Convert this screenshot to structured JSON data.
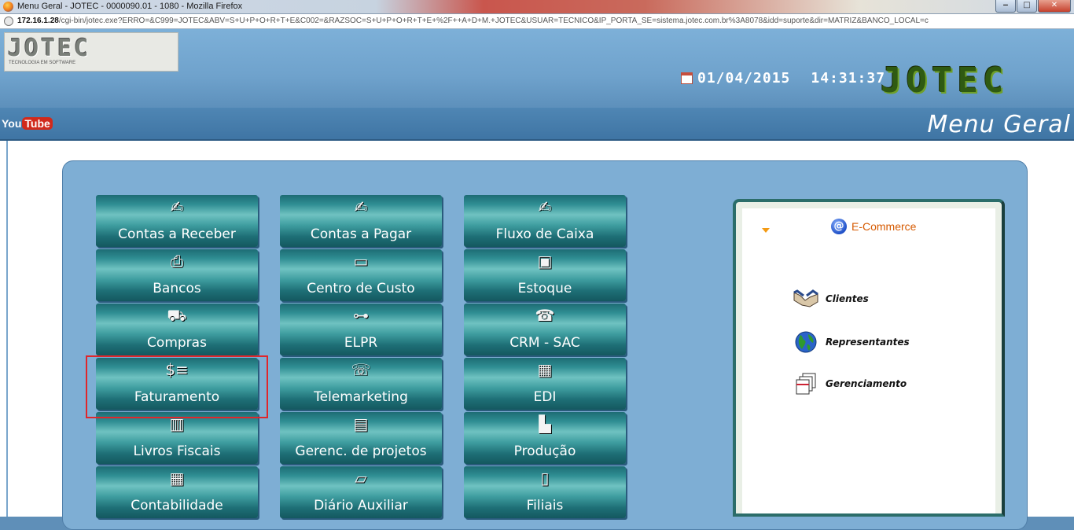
{
  "window": {
    "title": "Menu Geral - JOTEC - 0000090.01 - 1080 - Mozilla Firefox",
    "minimize": "‒",
    "maximize": "□",
    "close": "✕"
  },
  "urlbar": {
    "host": "172.16.1.28",
    "path": "/cgi-bin/jotec.exe?ERRO=&C999=JOTEC&ABV=S+U+P+O+R+T+E&C002=&RAZSOC=S+U+P+O+R+T+E+%2F++A+D+M.+JOTEC&USUAR=TECNICO&IP_PORTA_SE=sistema.jotec.com.br%3A8078&idd=suporte&dir=MATRIZ&BANCO_LOCAL=c"
  },
  "header": {
    "logo_text": "JOTEC",
    "logo_subtitle": "TECNOLOGIA EM SOFTWARE",
    "date": "01/04/2015",
    "time": "14:31:37",
    "big_logo": "JOTEC",
    "youtube_you": "You",
    "youtube_tube": "Tube",
    "page_title": "Menu Geral"
  },
  "menu": {
    "items": [
      {
        "label": "Contas a Receber",
        "icon": "✍"
      },
      {
        "label": "Contas a Pagar",
        "icon": "✍"
      },
      {
        "label": "Fluxo de Caixa",
        "icon": "✍"
      },
      {
        "label": "Bancos",
        "icon": "⎙"
      },
      {
        "label": "Centro de Custo",
        "icon": "▭"
      },
      {
        "label": "Estoque",
        "icon": "▣"
      },
      {
        "label": "Compras",
        "icon": "⛟"
      },
      {
        "label": "ELPR",
        "icon": "⊶"
      },
      {
        "label": "CRM - SAC",
        "icon": "☎"
      },
      {
        "label": "Faturamento",
        "icon": "$≡"
      },
      {
        "label": "Telemarketing",
        "icon": "☏"
      },
      {
        "label": "EDI",
        "icon": "▦"
      },
      {
        "label": "Livros Fiscais",
        "icon": "▥"
      },
      {
        "label": "Gerenc. de projetos",
        "icon": "▤"
      },
      {
        "label": "Produção",
        "icon": "▙"
      },
      {
        "label": "Contabilidade",
        "icon": "▦"
      },
      {
        "label": "Diário Auxiliar",
        "icon": "▱"
      },
      {
        "label": "Filiais",
        "icon": "▯"
      }
    ]
  },
  "ecommerce": {
    "title": "E-Commerce",
    "at_symbol": "@",
    "items": [
      {
        "label": "Clientes",
        "icon": "handshake-icon"
      },
      {
        "label": "Representantes",
        "icon": "globe-icon"
      },
      {
        "label": "Gerenciamento",
        "icon": "documents-icon"
      }
    ]
  },
  "colors": {
    "highlight": "#e0262b",
    "button_teal": "#2f8e93",
    "ecommerce_title": "#d65a00"
  }
}
